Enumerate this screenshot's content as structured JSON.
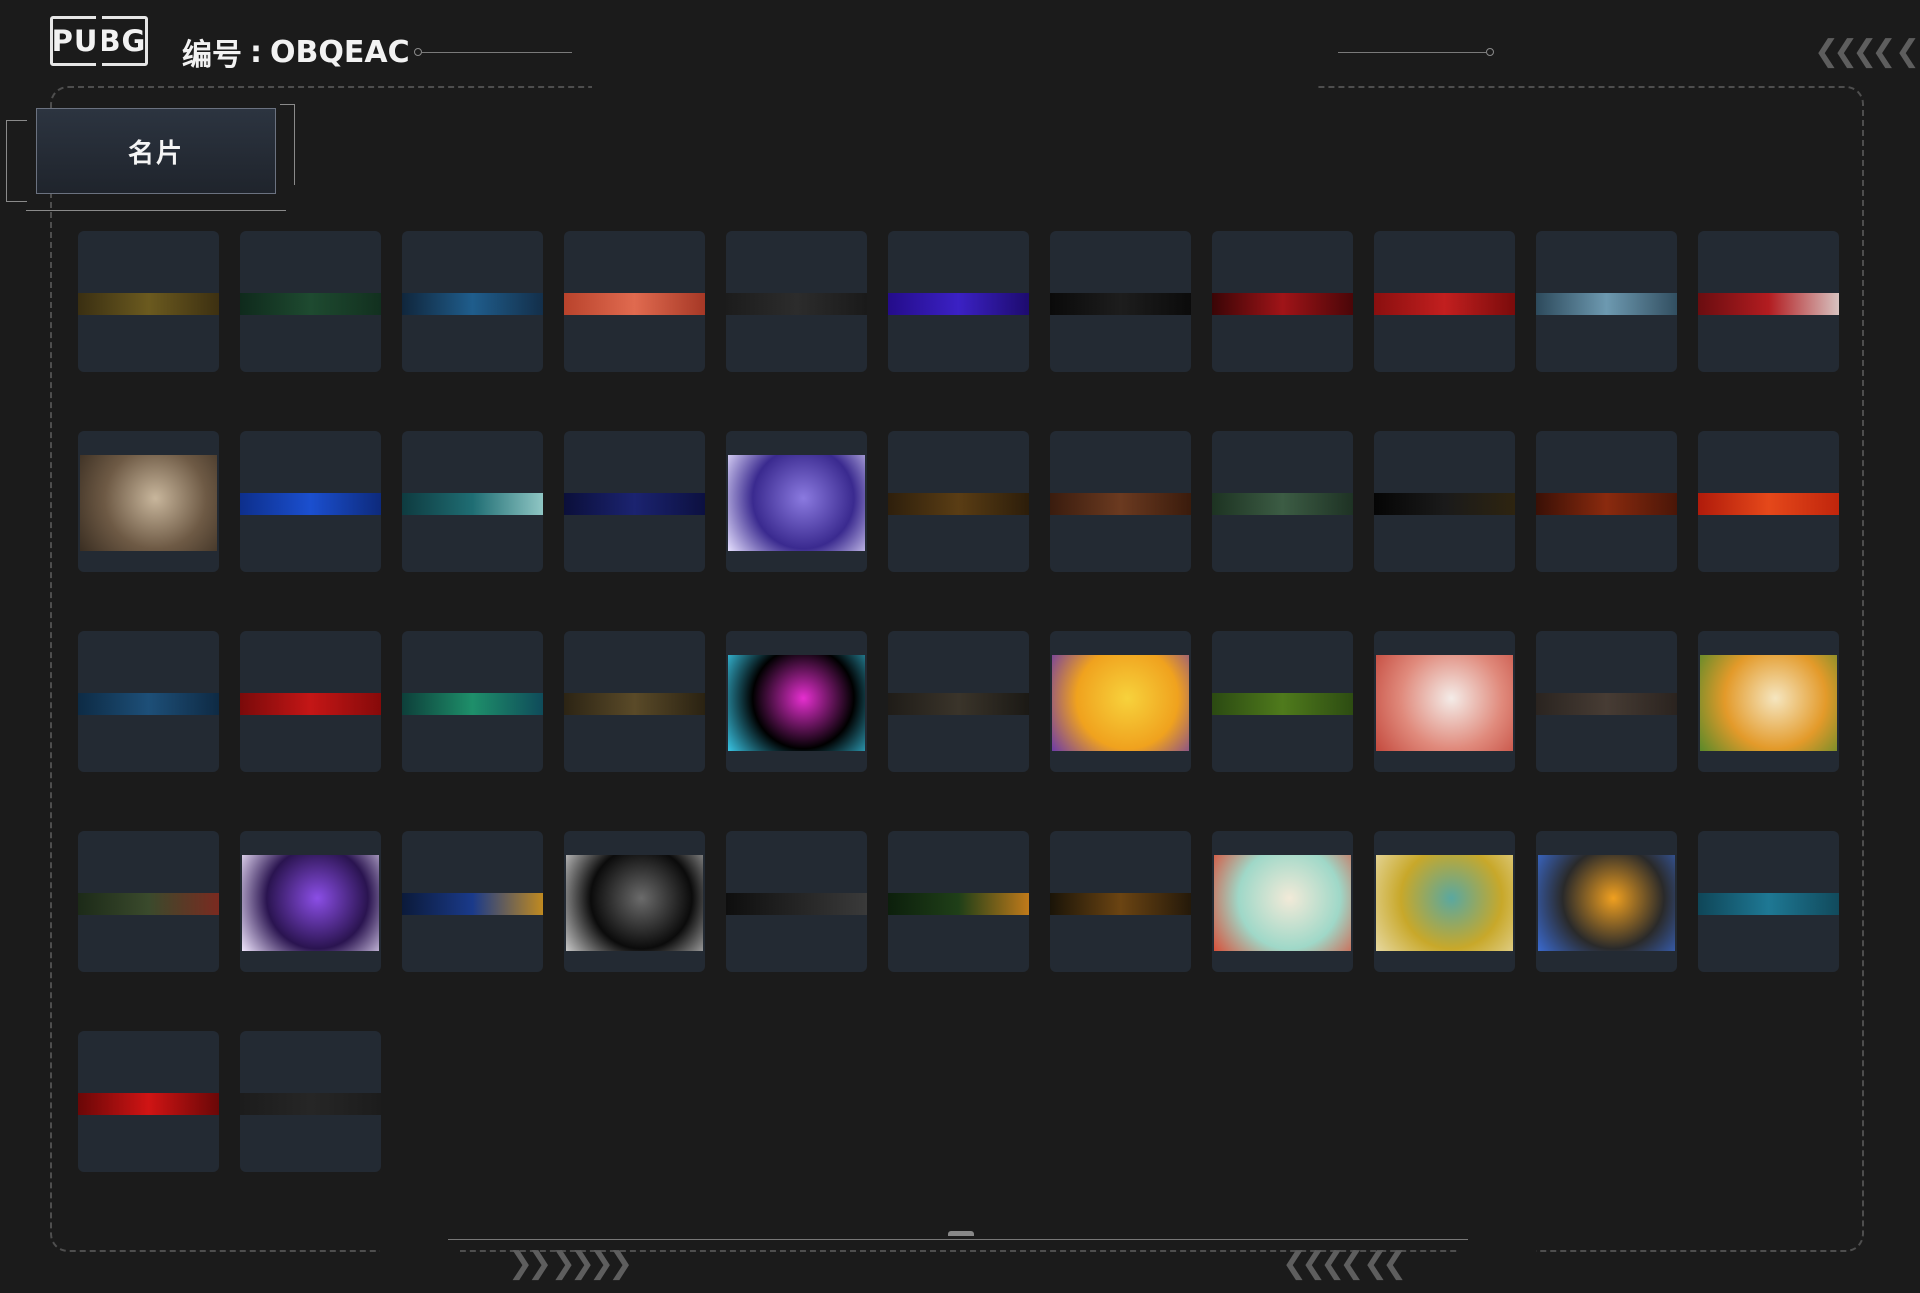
{
  "header": {
    "logo_text": "PUBG",
    "code_label": "编号",
    "code_sep": ":",
    "code_value": "OBQEAC"
  },
  "tab": {
    "label": "名片"
  },
  "decor": {
    "chevrons_top_right": "❮❮❮❮ ❮",
    "chevrons_bottom_left": "❯❯ ❯❯❯❯",
    "chevrons_bottom_right": "❮❮❮❮ ❮❮"
  },
  "cards": [
    {
      "kind": "strip",
      "colors": [
        "#3a2f12",
        "#6b5a1f",
        "#3d3011"
      ]
    },
    {
      "kind": "strip",
      "colors": [
        "#0f2a1c",
        "#1e4a30",
        "#12301f"
      ]
    },
    {
      "kind": "strip",
      "colors": [
        "#10263c",
        "#1f5d8c",
        "#132f4a"
      ]
    },
    {
      "kind": "strip",
      "colors": [
        "#b9432c",
        "#e06a4f",
        "#a63826"
      ]
    },
    {
      "kind": "strip",
      "colors": [
        "#1c1c1c",
        "#2c2c2c",
        "#1a1a1a"
      ]
    },
    {
      "kind": "strip",
      "colors": [
        "#240c8a",
        "#3b21c4",
        "#1d0b6e"
      ]
    },
    {
      "kind": "strip",
      "colors": [
        "#0a0a0a",
        "#1d1d1d",
        "#0b0b0b"
      ]
    },
    {
      "kind": "strip",
      "colors": [
        "#3a0506",
        "#a01418",
        "#4a0608"
      ]
    },
    {
      "kind": "strip",
      "colors": [
        "#8a0f0f",
        "#c21f1f",
        "#7a0b0b"
      ]
    },
    {
      "kind": "strip",
      "colors": [
        "#2d4a5c",
        "#6d99b0",
        "#324f61"
      ]
    },
    {
      "kind": "strip",
      "colors": [
        "#6a0d10",
        "#b21c20",
        "#d7c2c0"
      ]
    },
    {
      "kind": "picture",
      "colors": [
        "#6e5a45",
        "#c8b69c",
        "#3a2e22"
      ],
      "icon": "soldier-picture"
    },
    {
      "kind": "strip",
      "colors": [
        "#0d2f8c",
        "#1b4fcf",
        "#0d2a7c"
      ]
    },
    {
      "kind": "strip",
      "colors": [
        "#0e3b40",
        "#1f6d73",
        "#8fc6c4"
      ]
    },
    {
      "kind": "strip",
      "colors": [
        "#0b0f3a",
        "#1b2370",
        "#0c1040"
      ]
    },
    {
      "kind": "picture",
      "colors": [
        "#3a2a8f",
        "#8b7ae0",
        "#e6e0ff"
      ],
      "icon": "disco-ball-picture"
    },
    {
      "kind": "strip",
      "colors": [
        "#2e1f0c",
        "#5a3d14",
        "#2c1d0a"
      ]
    },
    {
      "kind": "strip",
      "colors": [
        "#3a1c0e",
        "#6b3a20",
        "#3a1b0c"
      ]
    },
    {
      "kind": "strip",
      "colors": [
        "#1d3322",
        "#3c5c44",
        "#1e3224"
      ]
    },
    {
      "kind": "strip",
      "colors": [
        "#050505",
        "#1a1a1a",
        "#2e2410"
      ]
    },
    {
      "kind": "strip",
      "colors": [
        "#3a1006",
        "#8a2a0e",
        "#4a1608"
      ]
    },
    {
      "kind": "strip",
      "colors": [
        "#b01b0b",
        "#e5481a",
        "#c0250c"
      ]
    },
    {
      "kind": "strip",
      "colors": [
        "#0d2b45",
        "#1d4f78",
        "#0e2a44"
      ]
    },
    {
      "kind": "strip",
      "colors": [
        "#7a0a0a",
        "#c41616",
        "#860a0a"
      ]
    },
    {
      "kind": "strip",
      "colors": [
        "#0d3f3a",
        "#1e8f6a",
        "#0f4b5a"
      ]
    },
    {
      "kind": "strip",
      "colors": [
        "#2c2414",
        "#5a4a28",
        "#2a2212"
      ]
    },
    {
      "kind": "picture",
      "colors": [
        "#000000",
        "#e62fd0",
        "#39c6e6"
      ],
      "icon": "equalizer-picture"
    },
    {
      "kind": "strip",
      "colors": [
        "#1f1c18",
        "#3a342a",
        "#1b1915"
      ]
    },
    {
      "kind": "picture",
      "colors": [
        "#f0a21e",
        "#f7d23c",
        "#6d3ba8"
      ],
      "icon": "bang-comic-picture"
    },
    {
      "kind": "strip",
      "colors": [
        "#2b4a12",
        "#4f7a1c",
        "#2d4c12"
      ]
    },
    {
      "kind": "picture",
      "colors": [
        "#e08a7c",
        "#f4ece8",
        "#c44a3e"
      ],
      "icon": "white-dragon-picture"
    },
    {
      "kind": "strip",
      "colors": [
        "#2a2420",
        "#473c34",
        "#2a231f"
      ]
    },
    {
      "kind": "picture",
      "colors": [
        "#e39a2a",
        "#f5e6c0",
        "#5a8a2a"
      ],
      "icon": "tiger-picture"
    },
    {
      "kind": "strip",
      "colors": [
        "#1c2a18",
        "#3a4a2c",
        "#7a2a20"
      ]
    },
    {
      "kind": "picture",
      "colors": [
        "#2a1450",
        "#8b4ee6",
        "#f0e6ff"
      ],
      "icon": "purple-orb-picture"
    },
    {
      "kind": "strip",
      "colors": [
        "#0b1a3a",
        "#1a3a8a",
        "#c08a20"
      ]
    },
    {
      "kind": "picture",
      "colors": [
        "#0b0b0b",
        "#6b6b6b",
        "#c9c9c9"
      ],
      "icon": "gun-barrel-picture"
    },
    {
      "kind": "strip",
      "colors": [
        "#0e0e0e",
        "#242424",
        "#3a3a3a"
      ]
    },
    {
      "kind": "strip",
      "colors": [
        "#0c1f0c",
        "#1f3f18",
        "#c07a1a"
      ]
    },
    {
      "kind": "strip",
      "colors": [
        "#1a1408",
        "#6b4412",
        "#24190a"
      ]
    },
    {
      "kind": "picture",
      "colors": [
        "#9fd8c8",
        "#f2ead8",
        "#d8503a"
      ],
      "icon": "twin-dragons-picture"
    },
    {
      "kind": "picture",
      "colors": [
        "#c8a82a",
        "#5aa8a0",
        "#e6d8a0"
      ],
      "icon": "frog-knight-picture"
    },
    {
      "kind": "picture",
      "colors": [
        "#2a2a2a",
        "#f0a020",
        "#3a6ad0"
      ],
      "icon": "helmet-picture"
    },
    {
      "kind": "strip",
      "colors": [
        "#0f4658",
        "#1e7894",
        "#114a5c"
      ]
    },
    {
      "kind": "strip",
      "colors": [
        "#6a0707",
        "#d01414",
        "#6a0707"
      ]
    },
    {
      "kind": "strip",
      "colors": [
        "#1c1c1c",
        "#262626",
        "#1c1c1c"
      ]
    }
  ]
}
